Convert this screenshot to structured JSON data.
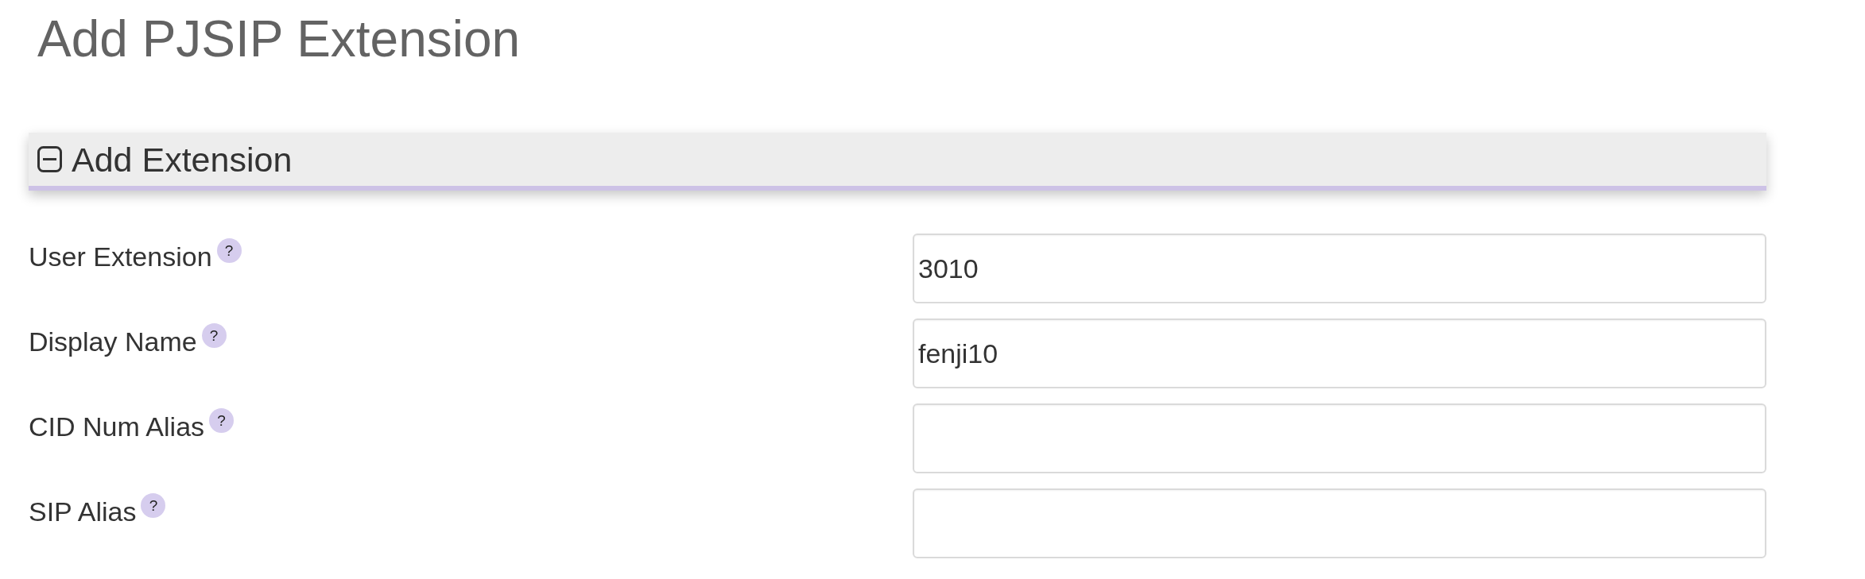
{
  "page": {
    "title": "Add PJSIP Extension"
  },
  "section": {
    "title": "Add Extension",
    "expanded": true,
    "fields": [
      {
        "label": "User Extension",
        "help": "?",
        "value": "3010"
      },
      {
        "label": "Display Name",
        "help": "?",
        "value": "fenji10"
      },
      {
        "label": "CID Num Alias",
        "help": "?"
      },
      {
        "label": "SIP Alias",
        "help": "?"
      }
    ]
  }
}
